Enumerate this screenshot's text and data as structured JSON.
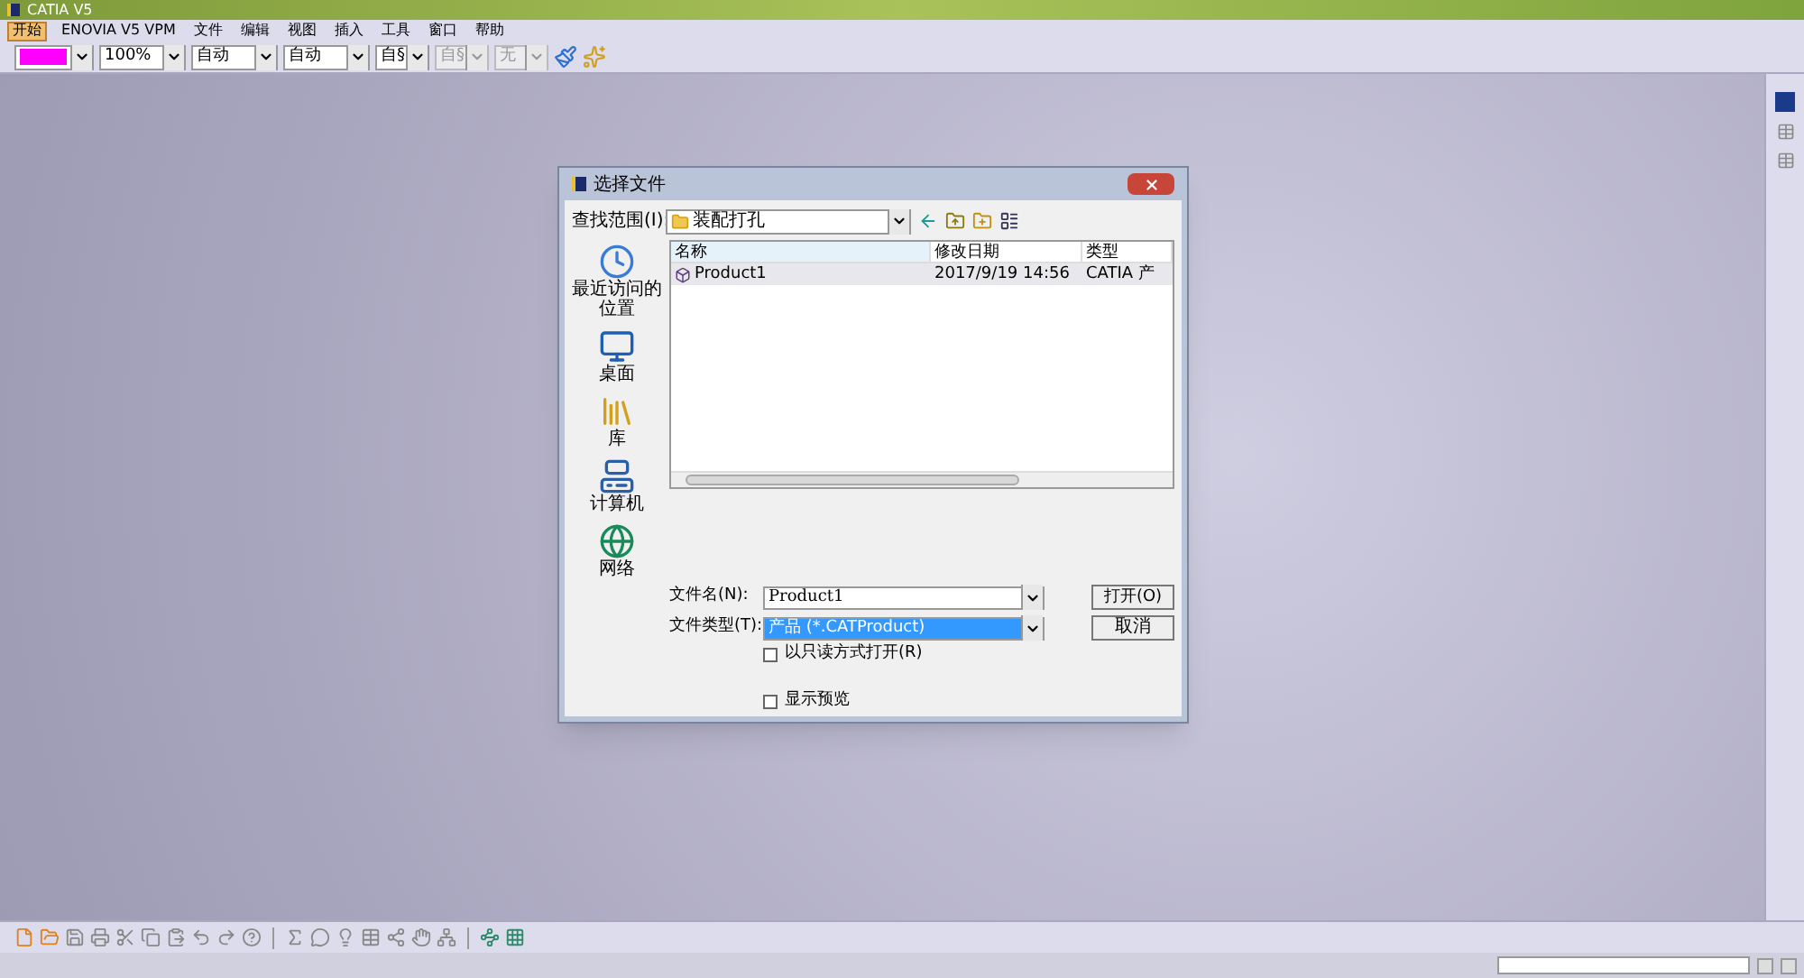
{
  "window": {
    "title": "CATIA V5"
  },
  "menu": [
    {
      "label": "开始",
      "selected": true
    },
    {
      "label": "ENOVIA V5 VPM",
      "selected": false
    },
    {
      "label": "文件",
      "selected": false
    },
    {
      "label": "编辑",
      "selected": false
    },
    {
      "label": "视图",
      "selected": false
    },
    {
      "label": "插入",
      "selected": false
    },
    {
      "label": "工具",
      "selected": false
    },
    {
      "label": "窗口",
      "selected": false
    },
    {
      "label": "帮助",
      "selected": false
    }
  ],
  "toolbar": {
    "color_picker": {
      "color": "#ff00ff"
    },
    "combos": [
      {
        "value": "100%",
        "disabled": false
      },
      {
        "value": "自动",
        "disabled": false
      },
      {
        "value": "自动",
        "disabled": false
      },
      {
        "value": "自§",
        "disabled": false
      },
      {
        "value": "自§",
        "disabled": true
      },
      {
        "value": "无",
        "disabled": true
      }
    ]
  },
  "dialog": {
    "title": "选择文件",
    "look_in_label": "查找范围(I):",
    "look_in_value": "装配打孔",
    "places": [
      {
        "kind": "recent",
        "label": "最近访问的位置"
      },
      {
        "kind": "desktop",
        "label": "桌面"
      },
      {
        "kind": "library",
        "label": "库"
      },
      {
        "kind": "computer",
        "label": "计算机"
      },
      {
        "kind": "network",
        "label": "网络"
      }
    ],
    "columns": [
      "名称",
      "修改日期",
      "类型"
    ],
    "rows": [
      {
        "name": "Product1",
        "date": "2017/9/19 14:56",
        "type": "CATIA 产",
        "selected": true
      }
    ],
    "file_name_label": "文件名(N):",
    "file_name_value": "Product1",
    "file_type_label": "文件类型(T):",
    "file_type_value": "产品 (*.CATProduct)",
    "open_button": "打开(O)",
    "cancel_button": "取消",
    "options": [
      {
        "label": "以只读方式打开(R)",
        "checked": false
      },
      {
        "label": "显示预览",
        "checked": false
      }
    ]
  }
}
